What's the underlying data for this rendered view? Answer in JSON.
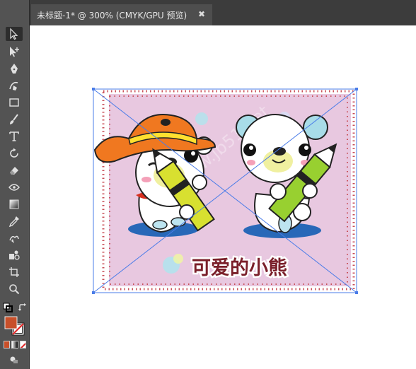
{
  "document_tab": {
    "title": "未标题-1* @ 300% (CMYK/GPU 预览)",
    "close_glyph": "✖"
  },
  "artwork": {
    "caption": "可爱的小熊",
    "watermark": "www.jb51.net",
    "background_color": "#e8c8e0",
    "border_dot_color": "#c8505a",
    "selection_color": "#4a7ce8",
    "hat_color": "#f07820",
    "pencil_color_left": "#d8e030",
    "pencil_color_right": "#98d030",
    "shadow_color": "#2868b8",
    "caption_color": "#7a1f2a"
  },
  "toolbar": {
    "tools": [
      {
        "name": "selection-tool",
        "icon": "arrow-icon",
        "active": true
      },
      {
        "name": "direct-selection-tool",
        "icon": "direct-arrow-icon"
      },
      {
        "name": "pen-tool",
        "icon": "pen-icon"
      },
      {
        "name": "curvature-tool",
        "icon": "curvature-icon"
      },
      {
        "name": "rectangle-tool",
        "icon": "rectangle-icon"
      },
      {
        "name": "paintbrush-tool",
        "icon": "brush-icon"
      },
      {
        "name": "type-tool",
        "icon": "type-icon"
      },
      {
        "name": "rotate-tool",
        "icon": "rotate-icon"
      },
      {
        "name": "eraser-tool",
        "icon": "eraser-icon"
      },
      {
        "name": "width-tool",
        "icon": "width-icon"
      },
      {
        "name": "gradient-tool",
        "icon": "gradient-icon"
      },
      {
        "name": "eyedropper-tool",
        "icon": "eyedropper-icon"
      },
      {
        "name": "shape-builder-tool",
        "icon": "shape-builder-icon"
      },
      {
        "name": "symbol-sprayer-tool",
        "icon": "symbol-sprayer-icon"
      },
      {
        "name": "artboard-tool",
        "icon": "artboard-icon"
      },
      {
        "name": "zoom-tool",
        "icon": "zoom-icon"
      }
    ],
    "fill_color": "#c8502a",
    "stroke": "none"
  }
}
